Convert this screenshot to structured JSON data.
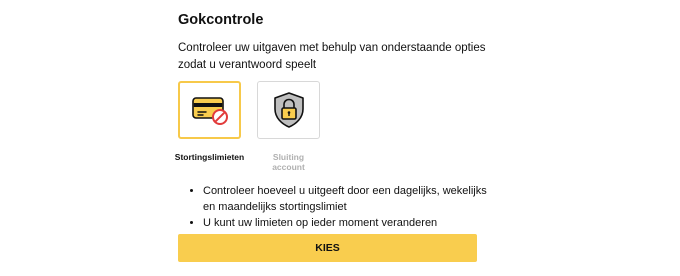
{
  "header": {
    "title": "Gokcontrole"
  },
  "description": "Controleer uw uitgaven met behulp van onderstaande opties zodat u verantwoord speelt",
  "options": [
    {
      "label": "Stortingslimieten",
      "icon": "credit-card-blocked-icon",
      "selected": true
    },
    {
      "label": "Sluiting account",
      "icon": "shield-lock-icon",
      "selected": false
    }
  ],
  "bullets": [
    "Controleer hoeveel u uitgeeft door een dagelijks, wekelijks en maandelijks stortingslimiet",
    "U kunt uw limieten op ieder moment veranderen"
  ],
  "actions": {
    "submit_label": "KIES"
  },
  "colors": {
    "accent": "#f9cd4e",
    "selected_border": "#f7c94a",
    "disabled_text": "#b0b0b0",
    "block_icon_red": "#e23b3b"
  }
}
